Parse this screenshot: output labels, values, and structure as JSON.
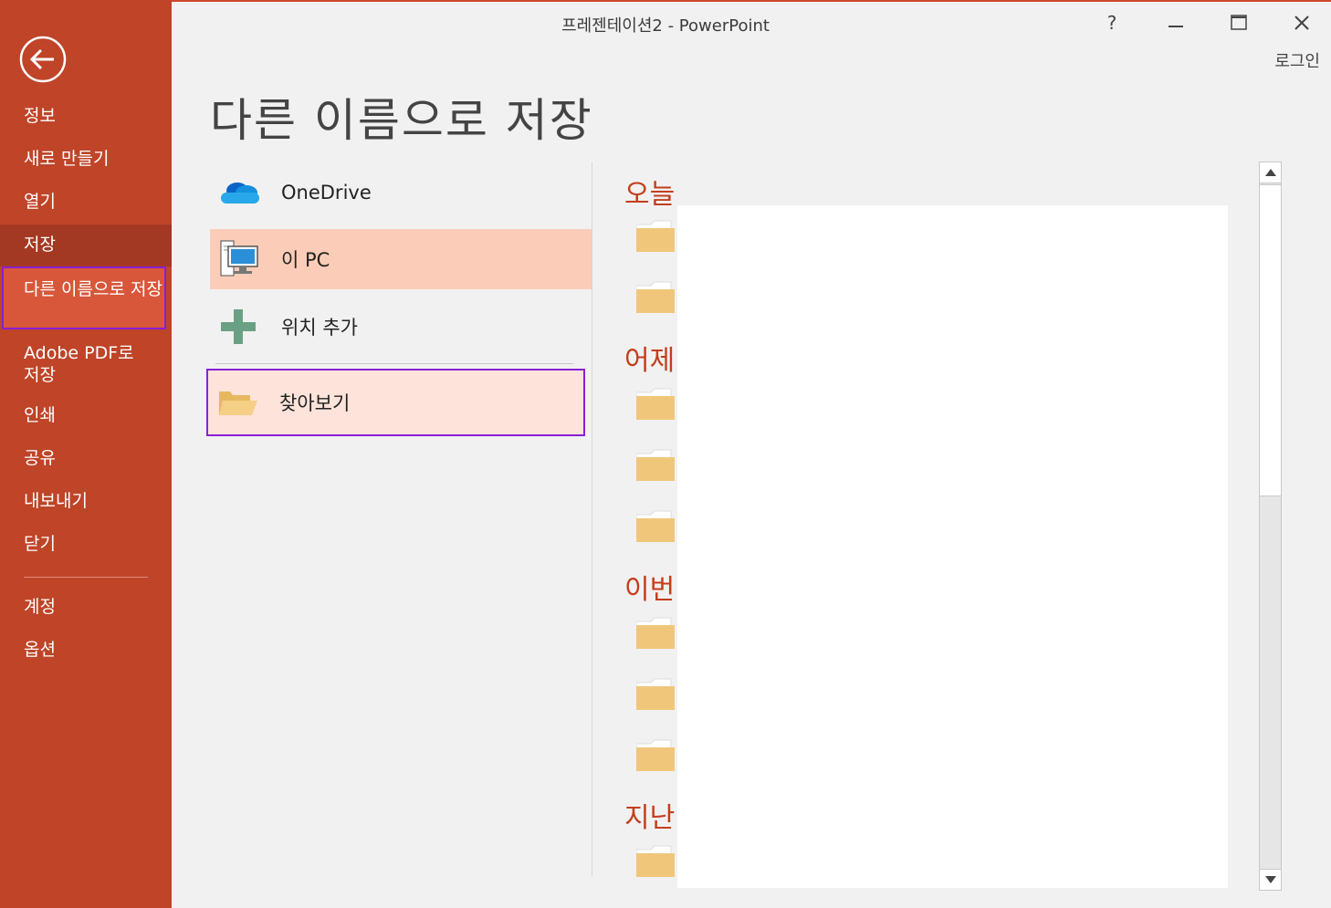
{
  "window": {
    "title": "프레젠테이션2 - PowerPoint",
    "help": "?",
    "signin": "로그인"
  },
  "sidebar": {
    "items": [
      {
        "label": "정보"
      },
      {
        "label": "새로 만들기"
      },
      {
        "label": "열기"
      },
      {
        "label": "저장"
      },
      {
        "label": "다른 이름으로 저장"
      },
      {
        "label": "Adobe PDF로 저장"
      },
      {
        "label": "인쇄"
      },
      {
        "label": "공유"
      },
      {
        "label": "내보내기"
      },
      {
        "label": "닫기"
      },
      {
        "label": "계정"
      },
      {
        "label": "옵션"
      }
    ]
  },
  "main": {
    "title": "다른 이름으로 저장",
    "locations": {
      "onedrive": "OneDrive",
      "this_pc": "이 PC",
      "add_place": "위치 추가",
      "browse": "찾아보기"
    },
    "groups": {
      "today": "오늘",
      "yesterday": "어제",
      "this_week": "이번",
      "older": "지난"
    }
  },
  "colors": {
    "accent": "#c43e1c",
    "sidebar": "#bf4428",
    "selected_location": "#fbcdb8",
    "highlight_border": "#8a1fd6"
  }
}
